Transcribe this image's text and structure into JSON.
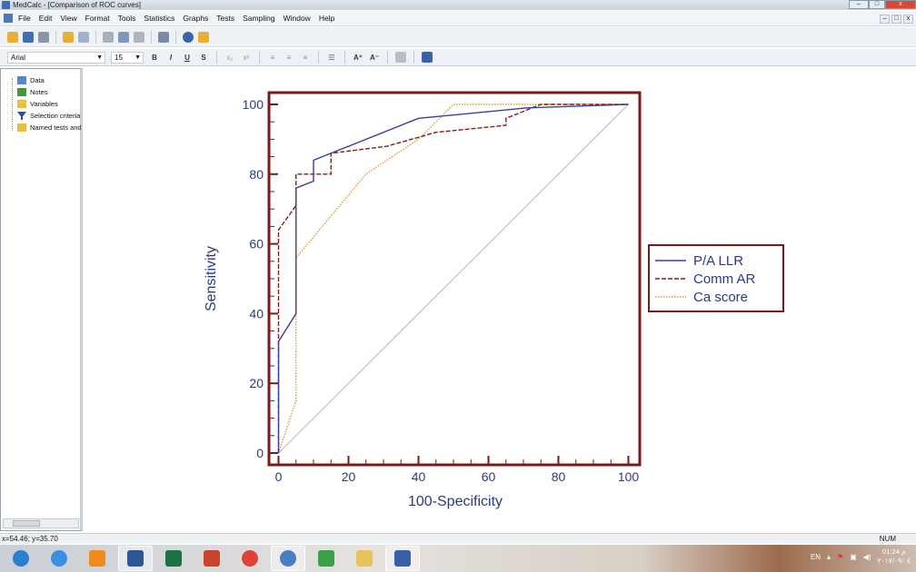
{
  "window": {
    "title": "MedCalc - [Comparison of ROC curves]",
    "minimize": "–",
    "maximize": "□",
    "close": "x"
  },
  "menu": {
    "items": [
      "File",
      "Edit",
      "View",
      "Format",
      "Tools",
      "Statistics",
      "Graphs",
      "Tests",
      "Sampling",
      "Window",
      "Help"
    ]
  },
  "toolbar": {
    "font": "Arial",
    "font_size": "15",
    "bold": "B",
    "italic": "I",
    "underline": "U",
    "strike": "S",
    "subscript": "x₂",
    "superscript": "x²",
    "grow": "A⁺",
    "shrink": "A⁻"
  },
  "tree": {
    "items": [
      {
        "label": "Data",
        "icon": "data-sheet-icon",
        "color": "#5b86c8"
      },
      {
        "label": "Notes",
        "icon": "notes-icon",
        "color": "#3f9a3a"
      },
      {
        "label": "Variables",
        "icon": "folder-icon",
        "color": "#e8c040"
      },
      {
        "label": "Selection criteria",
        "icon": "filter-icon",
        "color": "#2b4fb0"
      },
      {
        "label": "Named tests and graphs",
        "icon": "folder-icon",
        "color": "#e8c040"
      }
    ]
  },
  "chart_data": {
    "type": "line",
    "xlabel": "100-Specificity",
    "ylabel": "Sensitivity",
    "xlim": [
      0,
      100
    ],
    "ylim": [
      0,
      100
    ],
    "xticks": [
      "0",
      "20",
      "40",
      "60",
      "80",
      "100"
    ],
    "yticks": [
      "0",
      "20",
      "40",
      "60",
      "80",
      "100"
    ],
    "grid": false,
    "legend_placement": "right",
    "frame_color": "#7a1a1a",
    "series": [
      {
        "name": "P/A LLR",
        "style": "solid",
        "color": "#3a3f9a",
        "points": [
          [
            0,
            0
          ],
          [
            0,
            32
          ],
          [
            5,
            40
          ],
          [
            5,
            76
          ],
          [
            10,
            78
          ],
          [
            10,
            84
          ],
          [
            15,
            86
          ],
          [
            40,
            96
          ],
          [
            71,
            99
          ],
          [
            100,
            100
          ]
        ]
      },
      {
        "name": "Comm AR",
        "style": "dashed",
        "color": "#8b1a1a",
        "points": [
          [
            0,
            0
          ],
          [
            0,
            64
          ],
          [
            5,
            71
          ],
          [
            5,
            80
          ],
          [
            15,
            80
          ],
          [
            15,
            86
          ],
          [
            31,
            88
          ],
          [
            45,
            92
          ],
          [
            65,
            94
          ],
          [
            65,
            96
          ],
          [
            75,
            100
          ],
          [
            100,
            100
          ]
        ]
      },
      {
        "name": "Ca score",
        "style": "dotted",
        "color": "#e09a30",
        "points": [
          [
            0,
            0
          ],
          [
            5,
            15
          ],
          [
            5,
            56
          ],
          [
            25,
            80
          ],
          [
            40,
            90
          ],
          [
            50,
            100
          ],
          [
            100,
            100
          ]
        ]
      },
      {
        "style": "solid",
        "color": "#b8b8b8",
        "points": [
          [
            0,
            0
          ],
          [
            100,
            100
          ]
        ]
      }
    ]
  },
  "status": {
    "coords": "x=54.46; y=35.70",
    "num": "NUM"
  },
  "taskbar": {
    "apps": [
      {
        "icon": "start-icon",
        "color": "#2a7fd0"
      },
      {
        "icon": "ie-icon",
        "color": "#3a8fe0"
      },
      {
        "icon": "media-player-icon",
        "color": "#f08a1c"
      },
      {
        "icon": "word-icon",
        "color": "#2b5797"
      },
      {
        "icon": "excel-icon",
        "color": "#1e7145"
      },
      {
        "icon": "powerpoint-icon",
        "color": "#c8452b"
      },
      {
        "icon": "chrome-icon",
        "color": "#db4437"
      },
      {
        "icon": "app-icon",
        "color": "#4a7ec4"
      },
      {
        "icon": "excel-icon",
        "color": "#3aa04a"
      },
      {
        "icon": "explorer-icon",
        "color": "#e6c45a"
      },
      {
        "icon": "medcalc-icon",
        "color": "#3860a8"
      }
    ],
    "lang": "EN",
    "time": "01:24 م",
    "date": "٢٠١٧/٠٩/٠٤"
  }
}
